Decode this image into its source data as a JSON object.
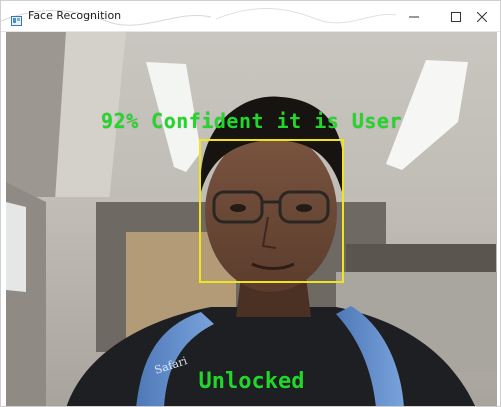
{
  "window": {
    "title": "Face Recognition",
    "controls": {
      "minimize_icon": "minimize-icon",
      "maximize_icon": "maximize-icon",
      "close_icon": "close-icon"
    }
  },
  "camera": {
    "confidence_label": "92% Confident it is User",
    "status_label": "Unlocked"
  },
  "colors": {
    "overlay_text": "#23d62a",
    "face_box": "#f0e31f"
  }
}
